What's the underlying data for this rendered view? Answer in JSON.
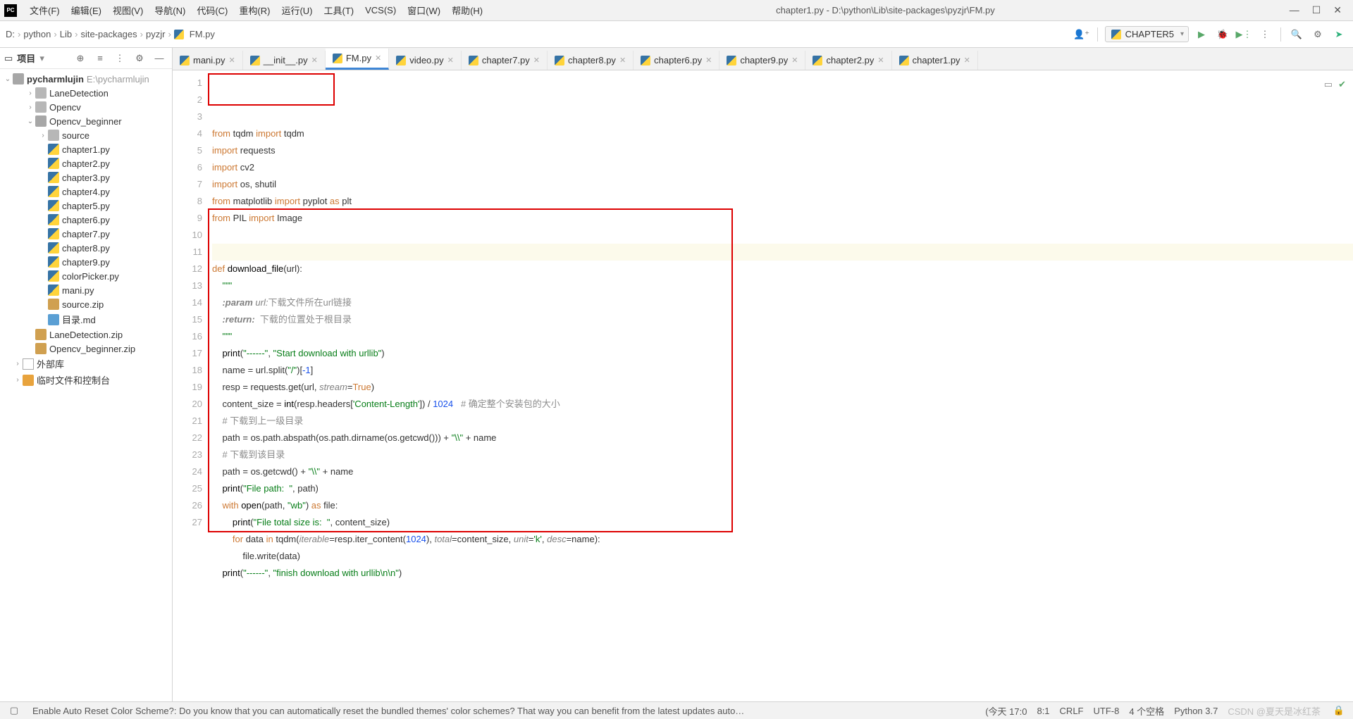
{
  "window": {
    "title": "chapter1.py - D:\\python\\Lib\\site-packages\\pyzjr\\FM.py"
  },
  "menu": {
    "file": "文件(F)",
    "edit": "编辑(E)",
    "view": "视图(V)",
    "nav": "导航(N)",
    "code": "代码(C)",
    "refactor": "重构(R)",
    "run": "运行(U)",
    "tools": "工具(T)",
    "vcs": "VCS(S)",
    "window": "窗口(W)",
    "help": "帮助(H)"
  },
  "breadcrumbs": [
    "D:",
    "python",
    "Lib",
    "site-packages",
    "pyzjr",
    "FM.py"
  ],
  "run_config": "CHAPTER5",
  "project_panel": {
    "title": "项目"
  },
  "tree": {
    "root": {
      "name": "pycharmlujin",
      "path": "E:\\pycharmlujin"
    },
    "items": [
      {
        "depth": 1,
        "chv": "›",
        "icon": "dir",
        "name": "LaneDetection"
      },
      {
        "depth": 1,
        "chv": "›",
        "icon": "dir",
        "name": "Opencv"
      },
      {
        "depth": 1,
        "chv": "⌄",
        "icon": "dir open",
        "name": "Opencv_beginner"
      },
      {
        "depth": 2,
        "chv": "›",
        "icon": "dir",
        "name": "source"
      },
      {
        "depth": 2,
        "chv": "",
        "icon": "py",
        "name": "chapter1.py"
      },
      {
        "depth": 2,
        "chv": "",
        "icon": "py",
        "name": "chapter2.py"
      },
      {
        "depth": 2,
        "chv": "",
        "icon": "py",
        "name": "chapter3.py"
      },
      {
        "depth": 2,
        "chv": "",
        "icon": "py",
        "name": "chapter4.py"
      },
      {
        "depth": 2,
        "chv": "",
        "icon": "py",
        "name": "chapter5.py"
      },
      {
        "depth": 2,
        "chv": "",
        "icon": "py",
        "name": "chapter6.py"
      },
      {
        "depth": 2,
        "chv": "",
        "icon": "py",
        "name": "chapter7.py"
      },
      {
        "depth": 2,
        "chv": "",
        "icon": "py",
        "name": "chapter8.py"
      },
      {
        "depth": 2,
        "chv": "",
        "icon": "py",
        "name": "chapter9.py"
      },
      {
        "depth": 2,
        "chv": "",
        "icon": "py",
        "name": "colorPicker.py"
      },
      {
        "depth": 2,
        "chv": "",
        "icon": "py",
        "name": "mani.py"
      },
      {
        "depth": 2,
        "chv": "",
        "icon": "zip",
        "name": "source.zip"
      },
      {
        "depth": 2,
        "chv": "",
        "icon": "md",
        "name": "目录.md"
      },
      {
        "depth": 1,
        "chv": "",
        "icon": "zip",
        "name": "LaneDetection.zip"
      },
      {
        "depth": 1,
        "chv": "",
        "icon": "zip",
        "name": "Opencv_beginner.zip"
      },
      {
        "depth": 0,
        "chv": "›",
        "icon": "lib",
        "name": "外部库"
      },
      {
        "depth": 0,
        "chv": "›",
        "icon": "scratch",
        "name": "临时文件和控制台"
      }
    ]
  },
  "tabs": [
    {
      "name": "mani.py"
    },
    {
      "name": "__init__.py"
    },
    {
      "name": "FM.py",
      "active": true
    },
    {
      "name": "video.py"
    },
    {
      "name": "chapter7.py"
    },
    {
      "name": "chapter8.py"
    },
    {
      "name": "chapter6.py"
    },
    {
      "name": "chapter9.py"
    },
    {
      "name": "chapter2.py"
    },
    {
      "name": "chapter1.py"
    }
  ],
  "code": {
    "lines": [
      {
        "n": 1,
        "html": "<span class='kw2'>from</span> tqdm <span class='kw2'>import</span> tqdm"
      },
      {
        "n": 2,
        "html": "<span class='kw2'>import</span> requests"
      },
      {
        "n": 3,
        "html": "<span class='kw2'>import</span> cv2"
      },
      {
        "n": 4,
        "html": "<span class='kw2'>import</span> os, shutil"
      },
      {
        "n": 5,
        "html": "<span class='kw2'>from</span> matplotlib <span class='kw2'>import</span> pyplot <span class='kw2'>as</span> plt"
      },
      {
        "n": 6,
        "html": "<span class='kw2'>from</span> PIL <span class='kw2'>import</span> Image"
      },
      {
        "n": 7,
        "html": ""
      },
      {
        "n": 8,
        "html": "",
        "hl": true
      },
      {
        "n": 9,
        "html": "<span class='kw2'>def </span><span class='fn'>download_file</span>(url):"
      },
      {
        "n": 10,
        "html": "    <span class='str'>\"\"\"</span>"
      },
      {
        "n": 11,
        "html": "    <span class='param'><b>:param</b> url:</span><span class='cmt'>下载文件所在url链接</span>"
      },
      {
        "n": 12,
        "html": "    <span class='param'><b>:return:</b></span>  <span class='cmt'>下载的位置处于根目录</span>"
      },
      {
        "n": 13,
        "html": "    <span class='str'>\"\"\"</span>"
      },
      {
        "n": 14,
        "html": "    <span class='ident'>print</span>(<span class='str'>\"------\"</span>, <span class='str'>\"Start download with urllib\"</span>)"
      },
      {
        "n": 15,
        "html": "    name = url.split(<span class='str'>\"/\"</span>)[<span class='num'>-1</span>]"
      },
      {
        "n": 16,
        "html": "    resp = requests.get(url, <span class='param'>stream</span>=<span class='kw2'>True</span>)"
      },
      {
        "n": 17,
        "html": "    content_size = <span class='ident'>int</span>(resp.headers[<span class='str'>'Content-Length'</span>]) / <span class='num'>1024</span>   <span class='cmt'># 确定整个安装包的大小</span>"
      },
      {
        "n": 18,
        "html": "    <span class='cmt'># 下载到上一级目录</span>"
      },
      {
        "n": 19,
        "html": "    path = os.path.abspath(os.path.dirname(os.getcwd())) + <span class='str'>\"\\\\\"</span> + name"
      },
      {
        "n": 20,
        "html": "    <span class='cmt'># 下载到该目录</span>"
      },
      {
        "n": 21,
        "html": "    path = os.getcwd() + <span class='str'>\"\\\\\"</span> + name"
      },
      {
        "n": 22,
        "html": "    <span class='ident'>print</span>(<span class='str'>\"File path:  \"</span>, path)"
      },
      {
        "n": 23,
        "html": "    <span class='kw2'>with </span><span class='ident'>open</span>(path, <span class='str'>\"wb\"</span>) <span class='kw2'>as</span> file:"
      },
      {
        "n": 24,
        "html": "        <span class='ident'>print</span>(<span class='str'>\"File total size is:  \"</span>, content_size)"
      },
      {
        "n": 25,
        "html": "        <span class='kw2'>for</span> data <span class='kw2'>in</span> tqdm(<span class='param'>iterable</span>=resp.iter_content(<span class='num'>1024</span>), <span class='param'>total</span>=content_size, <span class='param'>unit</span>=<span class='str'>'k'</span>, <span class='param'>desc</span>=name):"
      },
      {
        "n": 26,
        "html": "            file.write(data)"
      },
      {
        "n": 27,
        "html": "    <span class='ident'>print</span>(<span class='str'>\"------\"</span>, <span class='str'>\"finish download with urllib\\n\\n\"</span>)"
      }
    ]
  },
  "status": {
    "tip_label": "Enable Auto Reset Color Scheme?: Do you know that you can automatically reset the bundled themes' color schemes? That way you can benefit from the latest updates auto…",
    "time": "(今天 17:0",
    "pos": "8:1",
    "eol": "CRLF",
    "enc": "UTF-8",
    "indent": "4 个空格",
    "interp": "Python 3.7",
    "watermark": "CSDN @夏天是冰红茶"
  }
}
